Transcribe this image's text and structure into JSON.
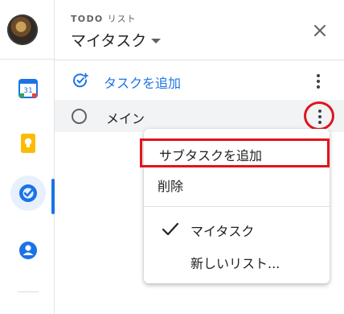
{
  "header": {
    "section_label_en": "TODO",
    "section_label_jp": "リスト",
    "list_title": "マイタスク"
  },
  "add_task": {
    "label": "タスクを追加"
  },
  "tasks": [
    {
      "title": "メイン"
    }
  ],
  "context_menu": {
    "add_subtask": "サブタスクを追加",
    "delete": "削除",
    "lists": [
      {
        "label": "マイタスク",
        "checked": true
      },
      {
        "label": "新しいリスト..."
      }
    ]
  },
  "icons": {
    "calendar": "calendar-icon",
    "keep": "keep-icon",
    "tasks": "tasks-icon",
    "contacts": "contacts-icon",
    "close": "close-icon",
    "add_task": "add-task-icon",
    "more": "more-vert-icon",
    "check": "checkmark-icon"
  },
  "colors": {
    "accent": "#1a73e8",
    "annotation_red": "#e0141e",
    "keep_yellow": "#fbbc04"
  }
}
